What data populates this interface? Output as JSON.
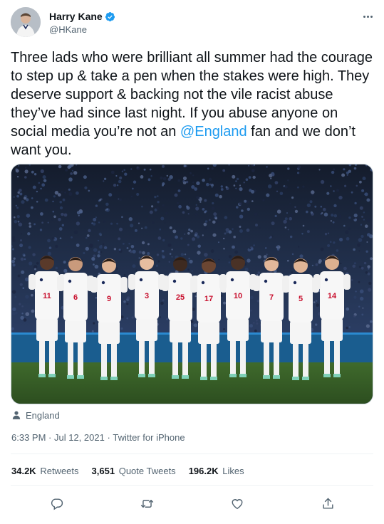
{
  "author": {
    "display_name": "Harry Kane",
    "handle": "@HKane",
    "verified": true,
    "avatar_icon": "avatar-photo"
  },
  "tweet": {
    "text_before": "Three lads who were brilliant all summer had the courage to step up & take a pen when the stakes were high. They deserve support & backing not the vile racist abuse they’ve had since last night. If you abuse anyone on social media you’re not an ",
    "mention": "@England",
    "text_after": " fan and we don’t want you."
  },
  "media": {
    "description_icon": "team-photo",
    "shirt_numbers": [
      "11",
      "6",
      "9",
      "3",
      "25",
      "17",
      "10",
      "7",
      "5",
      "14"
    ]
  },
  "location": {
    "icon": "person-icon",
    "label": "England"
  },
  "meta": {
    "time": "6:33 PM",
    "separator": " · ",
    "date": "Jul 12, 2021",
    "source": "Twitter for iPhone"
  },
  "stats": {
    "retweets_count": "34.2K",
    "retweets_label": "Retweets",
    "quotes_count": "3,651",
    "quotes_label": "Quote Tweets",
    "likes_count": "196.2K",
    "likes_label": "Likes"
  },
  "actions": [
    "reply-icon",
    "retweet-icon",
    "like-icon",
    "share-icon"
  ],
  "colors": {
    "accent": "#1d9bf0",
    "text": "#0f1419",
    "muted": "#536471",
    "border": "#eff3f4"
  }
}
